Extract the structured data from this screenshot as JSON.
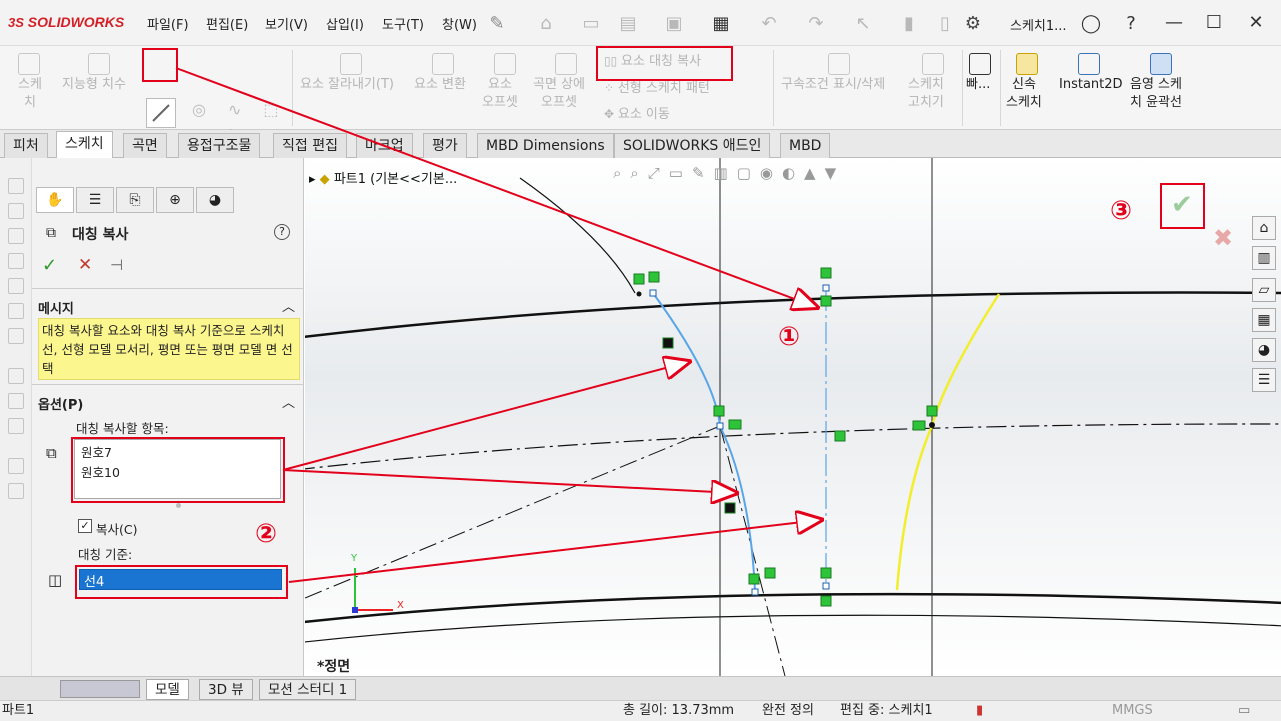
{
  "app": {
    "logo_text": "SOLIDWORKS",
    "doc_title": "스케치1..."
  },
  "menu": [
    "파일(F)",
    "편집(E)",
    "보기(V)",
    "삽입(I)",
    "도구(T)",
    "창(W)"
  ],
  "ribbon": {
    "sketch": "스케\n치",
    "smart_dim": "지능형 치수",
    "trim": "요소 잘라내기(T)",
    "convert": "요소 변환",
    "offset": "요소\n오프셋",
    "surface_offset": "곡면 상에\n오프셋",
    "mirror": "요소 대칭 복사",
    "linear_pattern": "선형 스케치 패턴",
    "move": "요소 이동",
    "relations": "구속조건 표시/삭제",
    "repair": "스케치\n고치기",
    "quick": "빠...",
    "rapid_sketch": "신속\n스케치",
    "instant2d": "Instant2D",
    "shaded": "음영 스케\n치 윤곽선"
  },
  "tabs": [
    "피처",
    "스케치",
    "곡면",
    "용접구조물",
    "직접 편집",
    "마크업",
    "평가",
    "MBD Dimensions",
    "SOLIDWORKS 애드인",
    "MBD"
  ],
  "active_tab": "스케치",
  "pm": {
    "title": "대칭 복사",
    "message_header": "메시지",
    "message": "대칭 복사할 요소와 대칭 복사 기준으로 스케치 선, 선형 모델 모서리, 평면 또는 평면 모델 면 선택",
    "options_header": "옵션(P)",
    "entities_label": "대칭 복사할 항목:",
    "entities": [
      "원호7",
      "원호10"
    ],
    "copy_label": "복사(C)",
    "copy_checked": true,
    "mirror_about_label": "대칭 기준:",
    "mirror_about_value": "선4"
  },
  "canvas": {
    "breadcrumb": "파트1  (기본<<기본...",
    "view_label": "*정면",
    "triad_y": "Y",
    "triad_x": "X"
  },
  "bottom_tabs": [
    "모델",
    "3D 뷰",
    "모션 스터디 1"
  ],
  "active_bottom_tab": "모델",
  "status": {
    "part": "파트1",
    "length": "총 길이: 13.73mm",
    "definition": "완전 정의",
    "editing": "편집 중: 스케치1",
    "units": "MMGS"
  },
  "annotations": {
    "n1": "①",
    "n2": "②",
    "n3": "③"
  },
  "colors": {
    "accent_red": "#e3001b",
    "selection_blue": "#1a74d1",
    "sketch_yellow": "#f2ee2a",
    "sketch_blue": "#5aa5e8",
    "message_yellow": "#fcf68f"
  }
}
